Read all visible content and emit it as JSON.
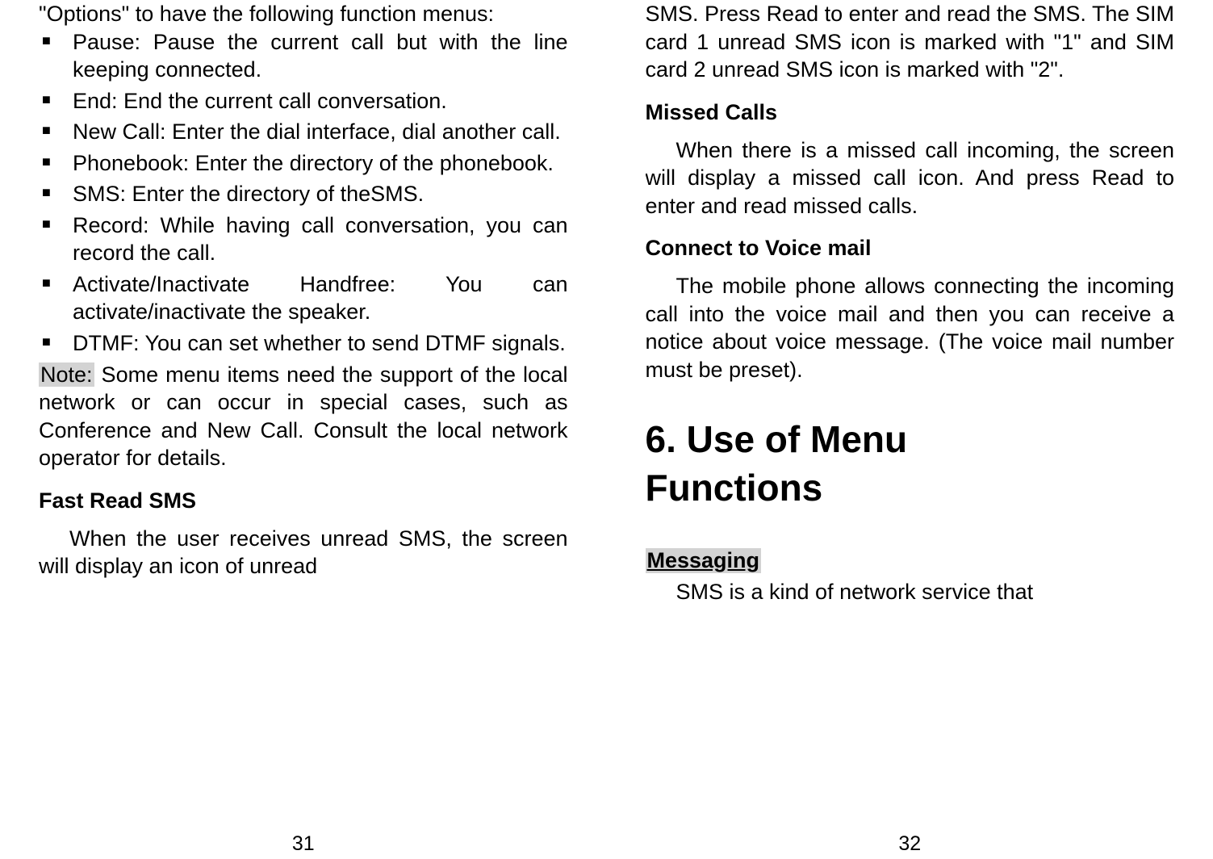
{
  "left": {
    "intro": "\"Options\" to have the following function menus:",
    "bullets": [
      "Pause: Pause the current call but with the line keeping connected.",
      "End: End the current call conversation.",
      "New Call: Enter the dial interface, dial another call.",
      "Phonebook: Enter the directory of the phonebook.",
      "SMS: Enter the directory of theSMS.",
      "Record: While having call conversation, you can record the call.",
      "Activate/Inactivate Handfree: You can activate/inactivate the speaker.",
      "DTMF: You can set whether to send DTMF signals."
    ],
    "note_label": "Note:",
    "note_rest": " Some menu items need the support of the local network or can occur in special cases, such as Conference and New Call. Consult the local network operator for details.",
    "fast_read_heading": "Fast Read SMS",
    "fast_read_body": "When the user receives unread SMS, the screen will display an icon of unread",
    "page_number": "31"
  },
  "right": {
    "sms_cont": "SMS. Press Read to enter and read the SMS. The SIM card 1 unread SMS icon is marked with \"1\" and SIM card 2 unread SMS icon is marked with \"2\".",
    "missed_heading": "Missed Calls",
    "missed_body": "When there is a missed call incoming, the screen will display a missed call icon. And press Read to enter and read missed calls.",
    "voicemail_heading": "Connect to Voice mail",
    "voicemail_body": "The mobile phone allows connecting the incoming call into the voice mail and then you can receive a notice about voice message. (The voice mail number must be preset).",
    "big_heading_line1": "6. Use of Menu",
    "big_heading_line2": "Functions",
    "messaging_heading": "Messaging",
    "messaging_body": "SMS is a kind of network service that",
    "page_number": "32"
  }
}
